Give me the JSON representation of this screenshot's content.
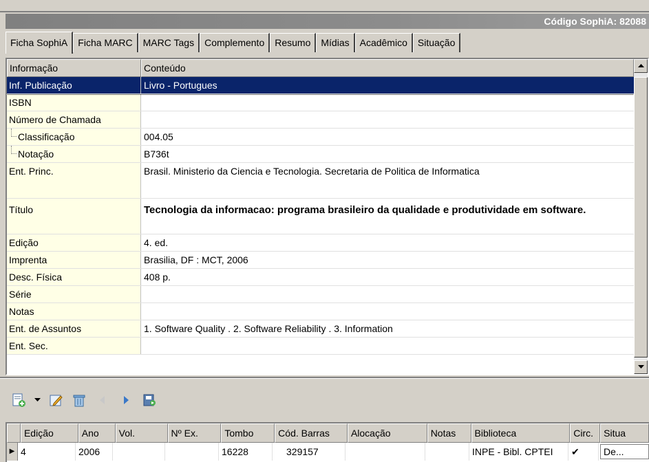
{
  "header": {
    "code_label": "Código SophiA: 82088"
  },
  "tabs": [
    {
      "label": "Ficha SophiA",
      "active": true
    },
    {
      "label": "Ficha MARC"
    },
    {
      "label": "MARC Tags"
    },
    {
      "label": "Complemento"
    },
    {
      "label": "Resumo"
    },
    {
      "label": "Mídias"
    },
    {
      "label": "Acadêmico"
    },
    {
      "label": "Situação"
    }
  ],
  "grid": {
    "columns": {
      "info": "Informação",
      "content": "Conteúdo"
    },
    "rows": [
      {
        "label": "Inf. Publicação",
        "value": "Livro - Portugues"
      },
      {
        "label": "ISBN",
        "value": ""
      },
      {
        "label": "Número de Chamada",
        "value": ""
      },
      {
        "label": "Classificação",
        "value": "004.05"
      },
      {
        "label": "Notação",
        "value": "B736t"
      },
      {
        "label": "Ent. Princ.",
        "value": "Brasil. Ministerio da Ciencia e Tecnologia. Secretaria de Politica de Informatica"
      },
      {
        "label": "Título",
        "value": "Tecnologia da informacao: programa brasileiro da qualidade e produtividade em software."
      },
      {
        "label": "Edição",
        "value": "4. ed."
      },
      {
        "label": "Imprenta",
        "value": "Brasilia, DF : MCT, 2006"
      },
      {
        "label": "Desc. Física",
        "value": "408 p."
      },
      {
        "label": "Série",
        "value": ""
      },
      {
        "label": "Notas",
        "value": ""
      },
      {
        "label": "Ent. de Assuntos",
        "value": "1. Software Quality . 2. Software Reliability . 3. Information"
      },
      {
        "label": "Ent. Sec.",
        "value": ""
      }
    ]
  },
  "toolbar": {
    "icons": [
      "new-document-icon",
      "dropdown-arrow-icon",
      "edit-icon",
      "delete-icon",
      "previous-icon",
      "next-icon",
      "save-icon"
    ]
  },
  "copies": {
    "columns": [
      "Edição",
      "Ano",
      "Vol.",
      "Nº Ex.",
      "Tombo",
      "Cód. Barras",
      "Alocação",
      "Notas",
      "Biblioteca",
      "Circ.",
      "Situa"
    ],
    "rows": [
      {
        "edicao": "4",
        "ano": "2006",
        "vol": "",
        "nex": "",
        "tombo": "16228",
        "cod_barras": "329157",
        "alocacao": "",
        "notas": "",
        "biblioteca": "INPE - Bibl. CPTEI",
        "circ": "✔",
        "situacao": "De..."
      }
    ]
  },
  "colors": {
    "selection": "#0a246a",
    "label_bg": "#ffffe6",
    "chrome": "#d4d0c8"
  }
}
